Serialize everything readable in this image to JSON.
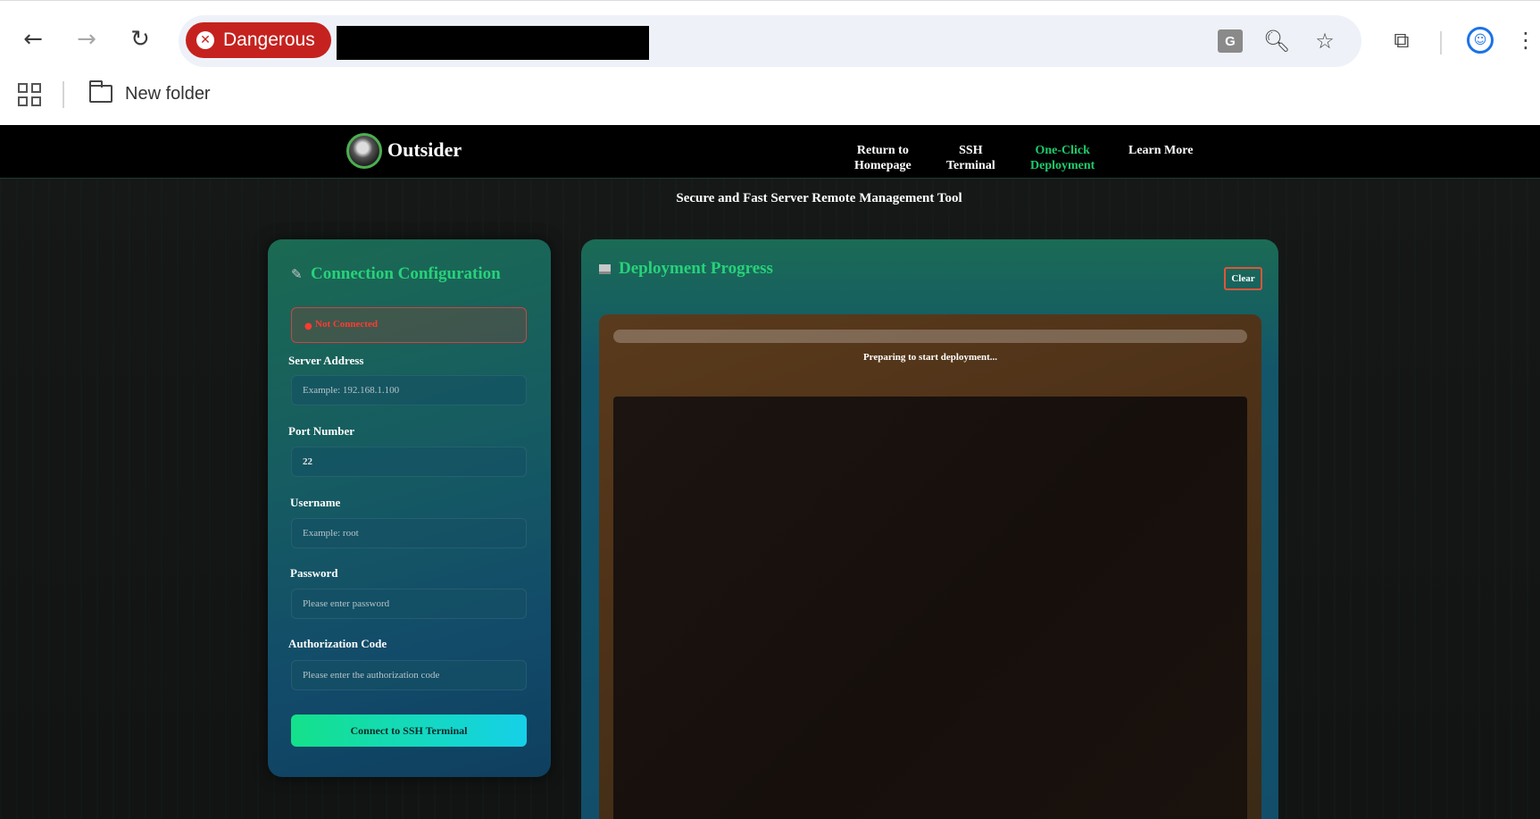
{
  "browser": {
    "security_chip": "Dangerous",
    "bookmark_folder": "New folder"
  },
  "site": {
    "brand": "Outsider",
    "nav": [
      {
        "line1": "Return to",
        "line2": "Homepage"
      },
      {
        "line1": "SSH",
        "line2": "Terminal"
      },
      {
        "line1": "One-Click",
        "line2": "Deployment"
      },
      {
        "line1": "Learn More",
        "line2": ""
      }
    ],
    "tagline": "Secure and Fast Server Remote Management Tool"
  },
  "connection": {
    "title": "Connection Configuration",
    "status": "Not Connected",
    "server_label": "Server Address",
    "server_placeholder": "Example: 192.168.1.100",
    "port_label": "Port Number",
    "port_value": "22",
    "username_label": "Username",
    "username_placeholder": "Example: root",
    "password_label": "Password",
    "password_placeholder": "Please enter password",
    "auth_label": "Authorization Code",
    "auth_placeholder": "Please enter the authorization code",
    "connect_button": "Connect to SSH Terminal"
  },
  "deployment": {
    "title": "Deployment Progress",
    "clear_button": "Clear",
    "progress": 0,
    "progress_text": "Preparing to start deployment..."
  },
  "colors": {
    "accent_green": "#27d27a",
    "danger_red": "#c5221f",
    "status_red": "#ff3b30"
  }
}
